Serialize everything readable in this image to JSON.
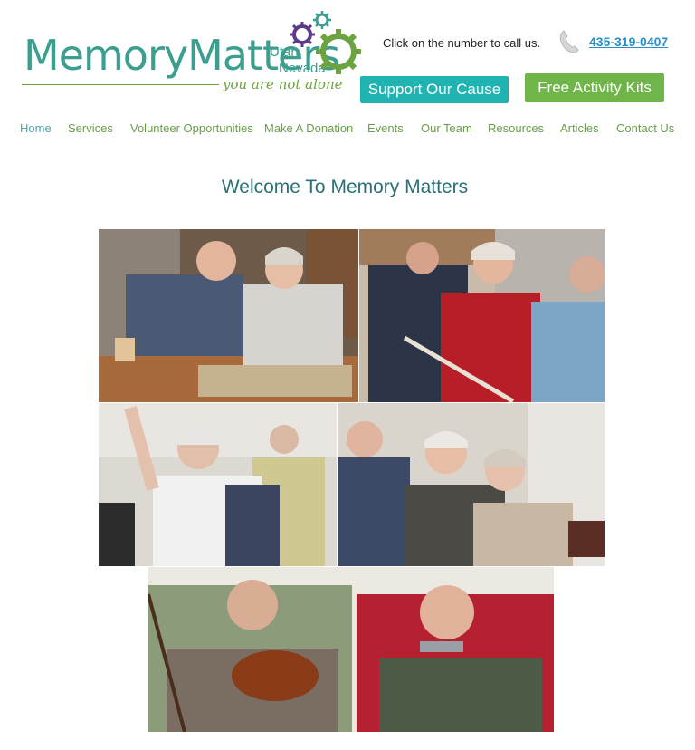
{
  "logo": {
    "name": "MemoryMatters",
    "region_line1": "Utah",
    "region_line2": "Nevada",
    "tagline": "you are not alone"
  },
  "header": {
    "call_text": "Click on the number to call us.",
    "phone": "435-319-0407",
    "support_button": "Support Our Cause",
    "kits_button": "Free Activity Kits"
  },
  "nav": {
    "items": [
      {
        "label": "Home"
      },
      {
        "label": "Services"
      },
      {
        "label": "Volunteer Opportunities"
      },
      {
        "label": "Make A Donation"
      },
      {
        "label": "Events"
      },
      {
        "label": "Our Team"
      },
      {
        "label": "Resources"
      },
      {
        "label": "Articles"
      },
      {
        "label": "Contact Us"
      }
    ]
  },
  "main": {
    "heading": "Welcome To Memory Matters"
  },
  "colors": {
    "teal": "#3b9e8e",
    "green": "#6aa33f",
    "purple": "#5b3a8c",
    "support_button": "#1fb4b2",
    "kits_button": "#6fb54a",
    "link_blue": "#2a8fc9"
  },
  "photos": [
    {
      "icon": "photo-seniors-scrapbook"
    },
    {
      "icon": "photo-seniors-exercise"
    },
    {
      "icon": "photo-woman-dancing"
    },
    {
      "icon": "photo-seniors-laughing"
    },
    {
      "icon": "photo-men-music"
    }
  ]
}
